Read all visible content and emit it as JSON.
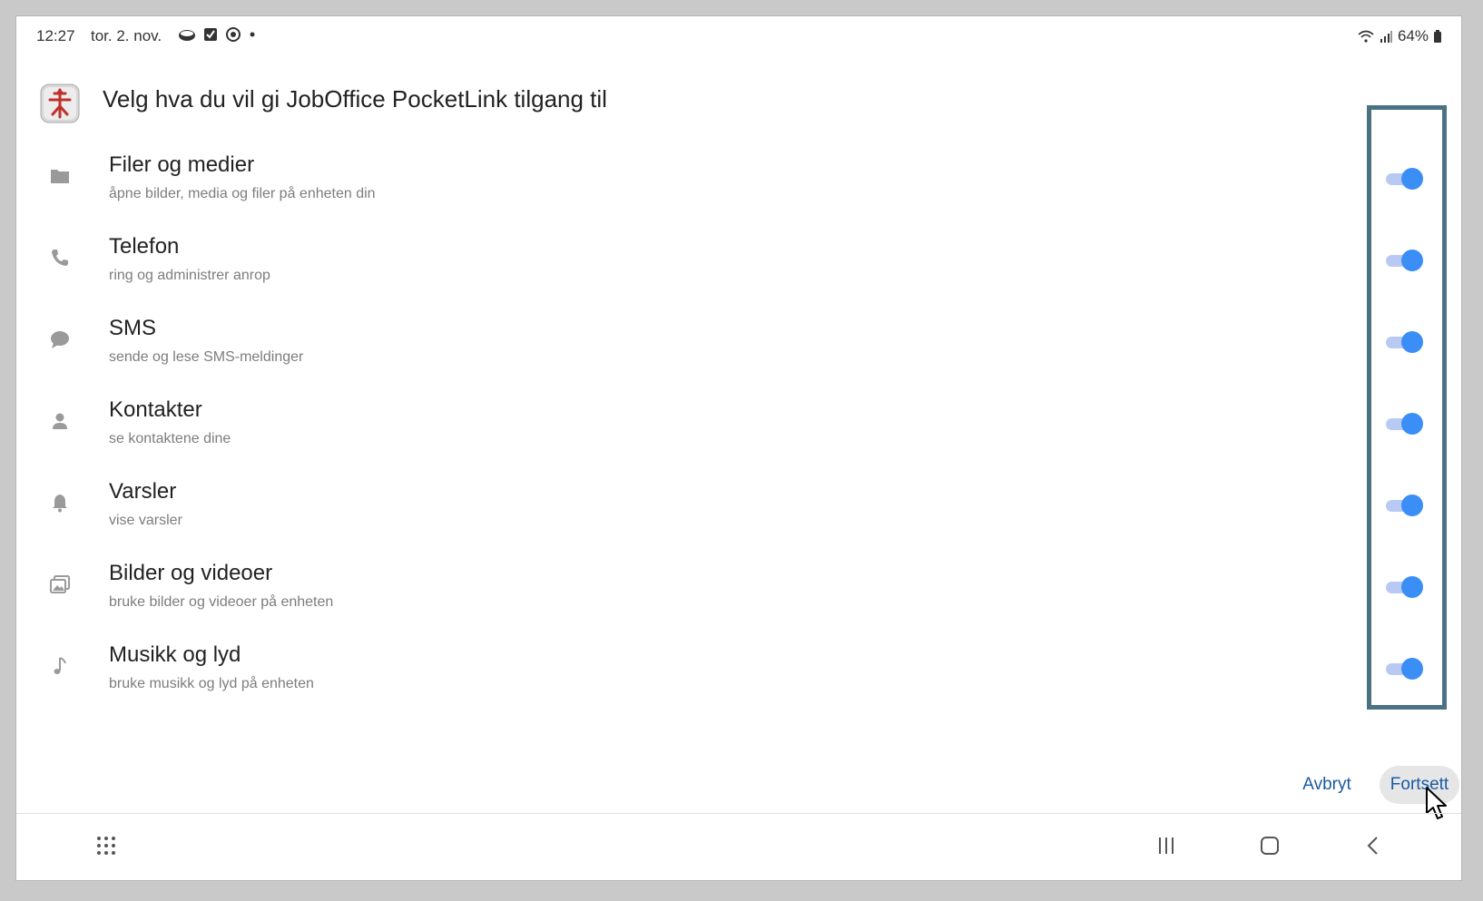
{
  "status_bar": {
    "time": "12:27",
    "date": "tor. 2. nov.",
    "battery": "64%"
  },
  "dialog": {
    "title": "Velg hva du vil gi JobOffice PocketLink tilgang til",
    "permissions": [
      {
        "icon": "folder-icon",
        "title": "Filer og medier",
        "subtitle": "åpne bilder, media og filer på enheten din",
        "enabled": true
      },
      {
        "icon": "phone-icon",
        "title": "Telefon",
        "subtitle": "ring og administrer anrop",
        "enabled": true
      },
      {
        "icon": "message-icon",
        "title": "SMS",
        "subtitle": "sende og lese SMS-meldinger",
        "enabled": true
      },
      {
        "icon": "person-icon",
        "title": "Kontakter",
        "subtitle": "se kontaktene dine",
        "enabled": true
      },
      {
        "icon": "bell-icon",
        "title": "Varsler",
        "subtitle": "vise varsler",
        "enabled": true
      },
      {
        "icon": "photo-icon",
        "title": "Bilder og videoer",
        "subtitle": "bruke bilder og videoer på enheten",
        "enabled": true
      },
      {
        "icon": "music-note-icon",
        "title": "Musikk og lyd",
        "subtitle": "bruke musikk og lyd på enheten",
        "enabled": true
      }
    ],
    "cancel_label": "Avbryt",
    "continue_label": "Fortsett"
  },
  "colors": {
    "accent": "#3a8ef6",
    "toggle_track": "#b8c9f4",
    "button_text": "#1a5aa4",
    "highlight_border": "#4a7283"
  }
}
